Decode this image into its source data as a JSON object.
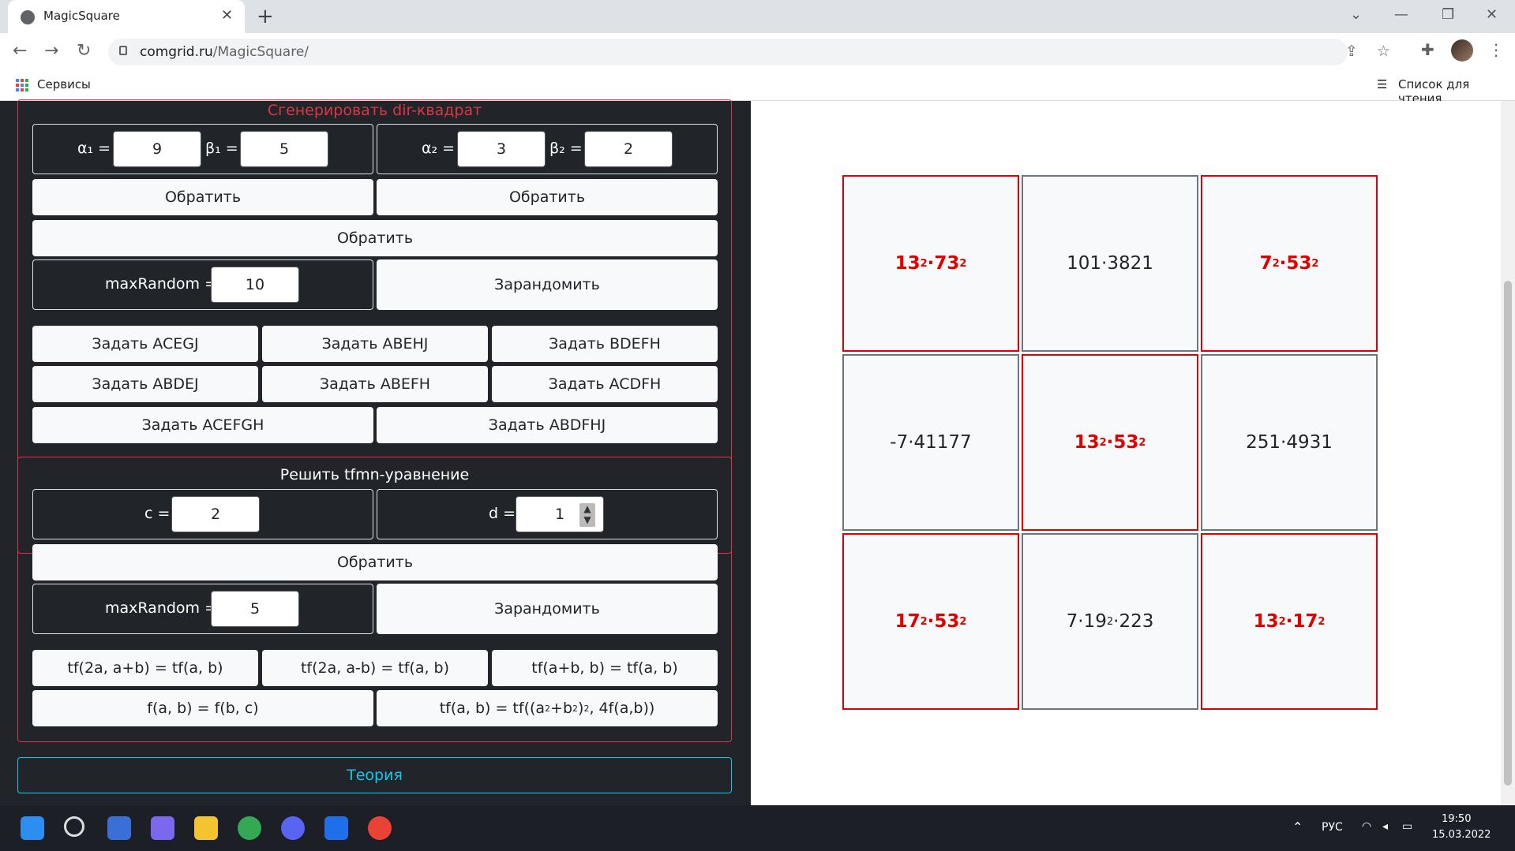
{
  "browser": {
    "tab_title": "MagicSquare",
    "url_domain": "comgrid.ru",
    "url_path": "/MagicSquare/",
    "bookmark_apps": "Сервисы",
    "reading_list": "Список для чтения"
  },
  "dir_section": {
    "title": "Сгенерировать dir-квадрат",
    "title_color": "#dc3545",
    "alpha1_label": "α₁ =",
    "alpha1": "9",
    "beta1_label": "β₁ =",
    "beta1": "5",
    "alpha2_label": "α₂ =",
    "alpha2": "3",
    "beta2_label": "β₂ =",
    "beta2": "2",
    "invert_left": "Обратить",
    "invert_right": "Обратить",
    "invert_full": "Обратить",
    "max_random_label": "maxRandom =",
    "max_random": "10",
    "randomize": "Зарандомить",
    "set_buttons": [
      "Задать ACEGJ",
      "Задать ABEHJ",
      "Задать BDEFH",
      "Задать ABDEJ",
      "Задать ABEFH",
      "Задать ACDFH"
    ],
    "set_wide": [
      "Задать ACEFGH",
      "Задать ABDFHJ"
    ]
  },
  "tfmn_section": {
    "title": "Решить tfmn-уравнение",
    "c_label": "c =",
    "c": "2",
    "d_label": "d =",
    "d": "1",
    "invert": "Обратить",
    "max_random_label": "maxRandom =",
    "max_random": "5",
    "randomize": "Зарандомить",
    "f1": "tf(2a, a+b) = tf(a, b)",
    "f2": "tf(2a, a-b) = tf(a, b)",
    "f3": "tf(a+b, b) = tf(a, b)",
    "f4": "f(a, b) = f(b, c)",
    "f5_a": "tf(a, b) = tf((a",
    "f5_b": "+b",
    "f5_c": ")",
    "f5_d": ", 4f(a,b))",
    "sup2": "2"
  },
  "theory": "Теория",
  "square": {
    "r0c0": {
      "a": "13",
      "b": "·73"
    },
    "r0c1": "101·3821",
    "r0c2": {
      "a": "7",
      "b": "·53"
    },
    "r1c0": "-7·41177",
    "r1c1": {
      "a": "13",
      "b": "·53"
    },
    "r1c2": "251·4931",
    "r2c0": {
      "a": "17",
      "b": "·53"
    },
    "r2c1": {
      "a": "7·19",
      "b": "·223"
    },
    "r2c2": {
      "a": "13",
      "b": "·17"
    },
    "exp": "2",
    "highlight_color": "#e00000"
  },
  "taskbar": {
    "lang": "РУС",
    "time": "19:50",
    "date": "15.03.2022"
  }
}
